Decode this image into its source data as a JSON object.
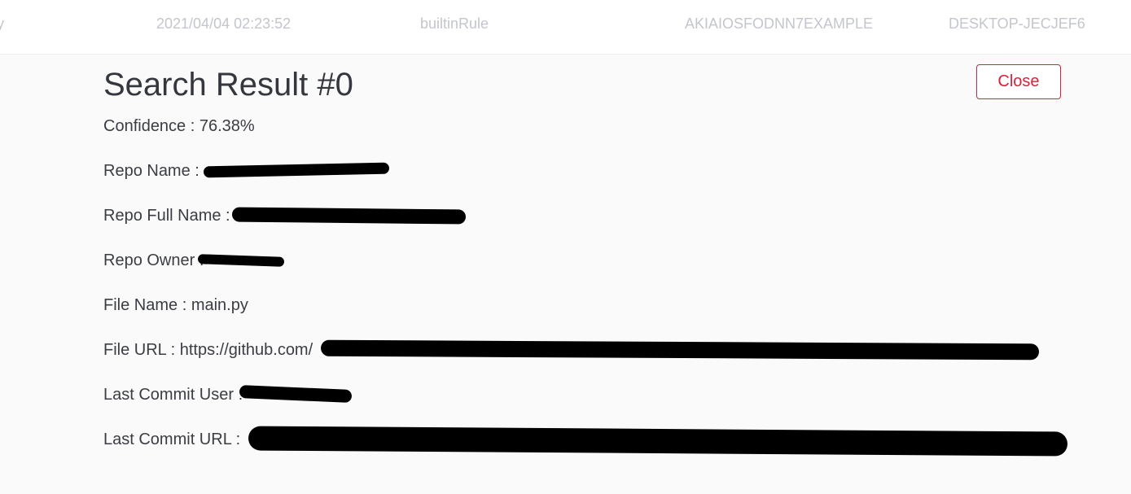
{
  "background_row": {
    "cells": [
      "y",
      "2021/04/04 02:23:52",
      "builtinRule",
      "AKIAIOSFODNN7EXAMPLE",
      "DESKTOP-JECJEF6"
    ]
  },
  "modal": {
    "title": "Search Result #0",
    "close_label": "Close",
    "fields": [
      {
        "label": "Confidence :",
        "value": "76.38%"
      },
      {
        "label": "Repo Name :",
        "value": ""
      },
      {
        "label": "Repo Full Name :",
        "value": ""
      },
      {
        "label": "Repo Owner :",
        "value": ""
      },
      {
        "label": "File Name :",
        "value": "main.py"
      },
      {
        "label": "File URL :",
        "value": "https://github.com/"
      },
      {
        "label": "Last Commit User :",
        "value": ""
      },
      {
        "label": "Last Commit URL :",
        "value": ""
      }
    ]
  },
  "colors": {
    "accent": "#d6223a",
    "text": "#3a3d44",
    "muted_text": "#c3c6cc",
    "redaction": "#000000"
  }
}
